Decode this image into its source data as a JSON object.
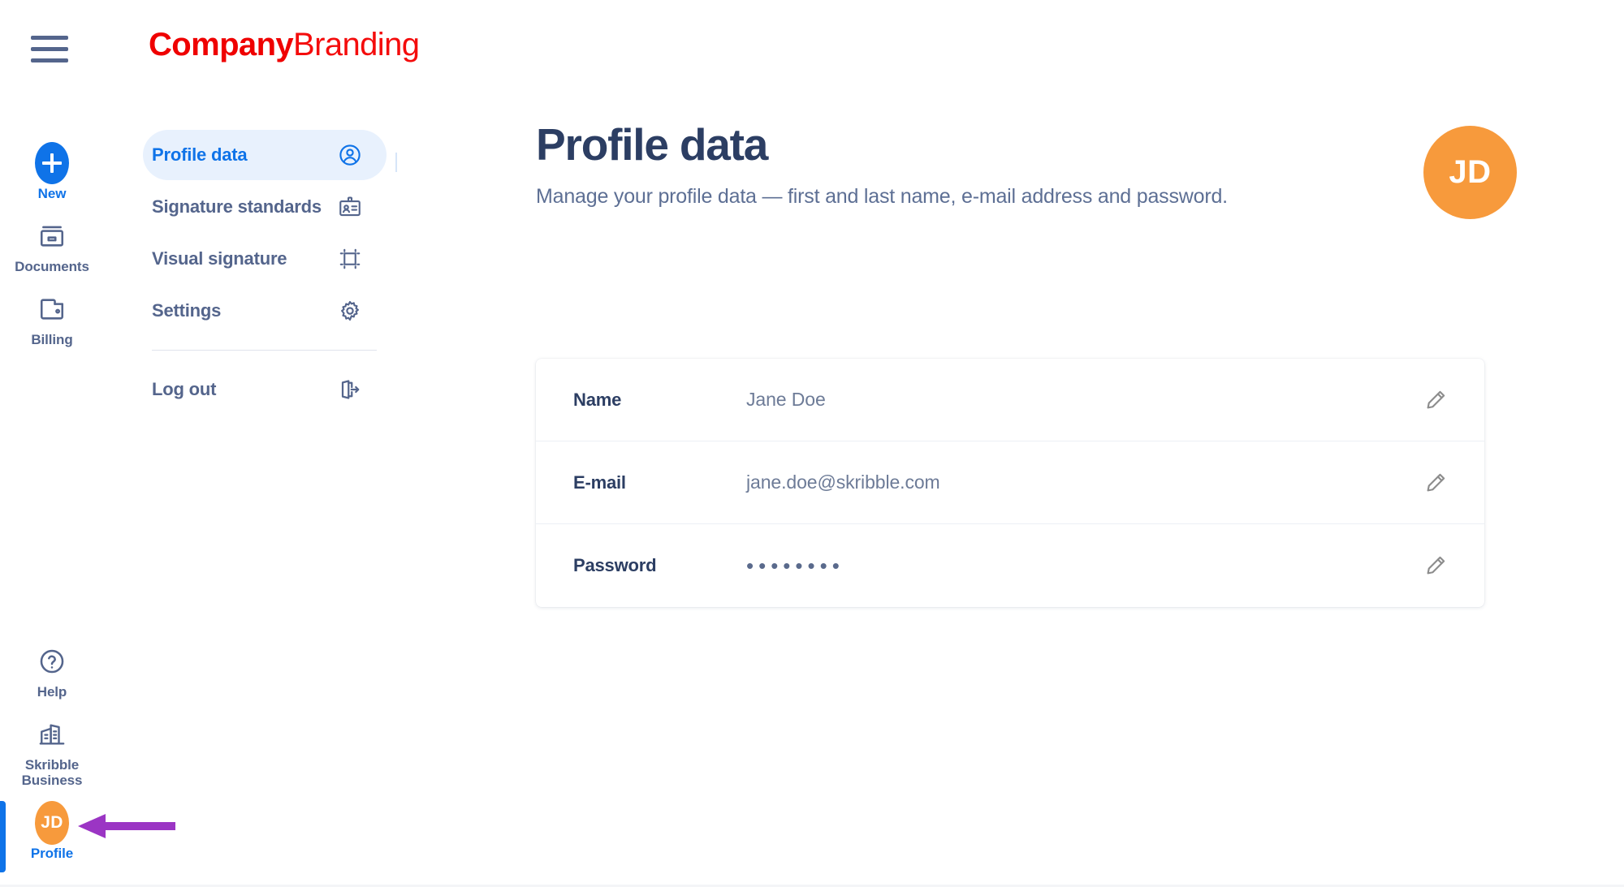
{
  "topbar": {
    "menu_icon": "hamburger-menu-icon",
    "logo_part1": "Company",
    "logo_part2": "Branding",
    "logo_color": "#ef0000"
  },
  "rail": {
    "top_items": [
      {
        "label": "New",
        "icon": "plus-circle-icon",
        "state": "accent"
      },
      {
        "label": "Documents",
        "icon": "archive-box-icon",
        "state": "default"
      },
      {
        "label": "Billing",
        "icon": "wallet-icon",
        "state": "default"
      }
    ],
    "bottom_items": [
      {
        "label": "Help",
        "icon": "question-circle-icon",
        "state": "default"
      },
      {
        "label": "Skribble\nBusiness",
        "icon": "office-building-icon",
        "state": "default"
      },
      {
        "label": "Profile",
        "icon": "avatar-initials-icon",
        "state": "active",
        "initials": "JD"
      }
    ],
    "active_indicator_color": "#0f73e8",
    "accent_color": "#0f73e8",
    "muted_color": "#54658c"
  },
  "annotation": {
    "arrow_color": "#9b35c4",
    "points_to": "profile-rail-item"
  },
  "navpanel": {
    "items": [
      {
        "label": "Profile data",
        "icon": "user-circle-icon",
        "selected": true
      },
      {
        "label": "Signature standards",
        "icon": "id-badge-icon",
        "selected": false
      },
      {
        "label": "Visual signature",
        "icon": "crop-frame-icon",
        "selected": false
      },
      {
        "label": "Settings",
        "icon": "gear-icon",
        "selected": false
      }
    ],
    "logout": {
      "label": "Log out",
      "icon": "logout-arrow-icon"
    },
    "selected_bg": "#e8f1fd",
    "selected_fg": "#0f73e8"
  },
  "main": {
    "title": "Profile data",
    "subtitle": "Manage your profile data — first and last name, e-mail address and password.",
    "avatar_initials": "JD",
    "avatar_color": "#f79a3c"
  },
  "card": {
    "rows": [
      {
        "label": "Name",
        "value": "Jane Doe",
        "edit_icon": "pencil-icon",
        "masked": false
      },
      {
        "label": "E-mail",
        "value": "jane.doe@skribble.com",
        "edit_icon": "pencil-icon",
        "masked": false
      },
      {
        "label": "Password",
        "value": "••••••••",
        "edit_icon": "pencil-icon",
        "masked": true
      }
    ]
  }
}
